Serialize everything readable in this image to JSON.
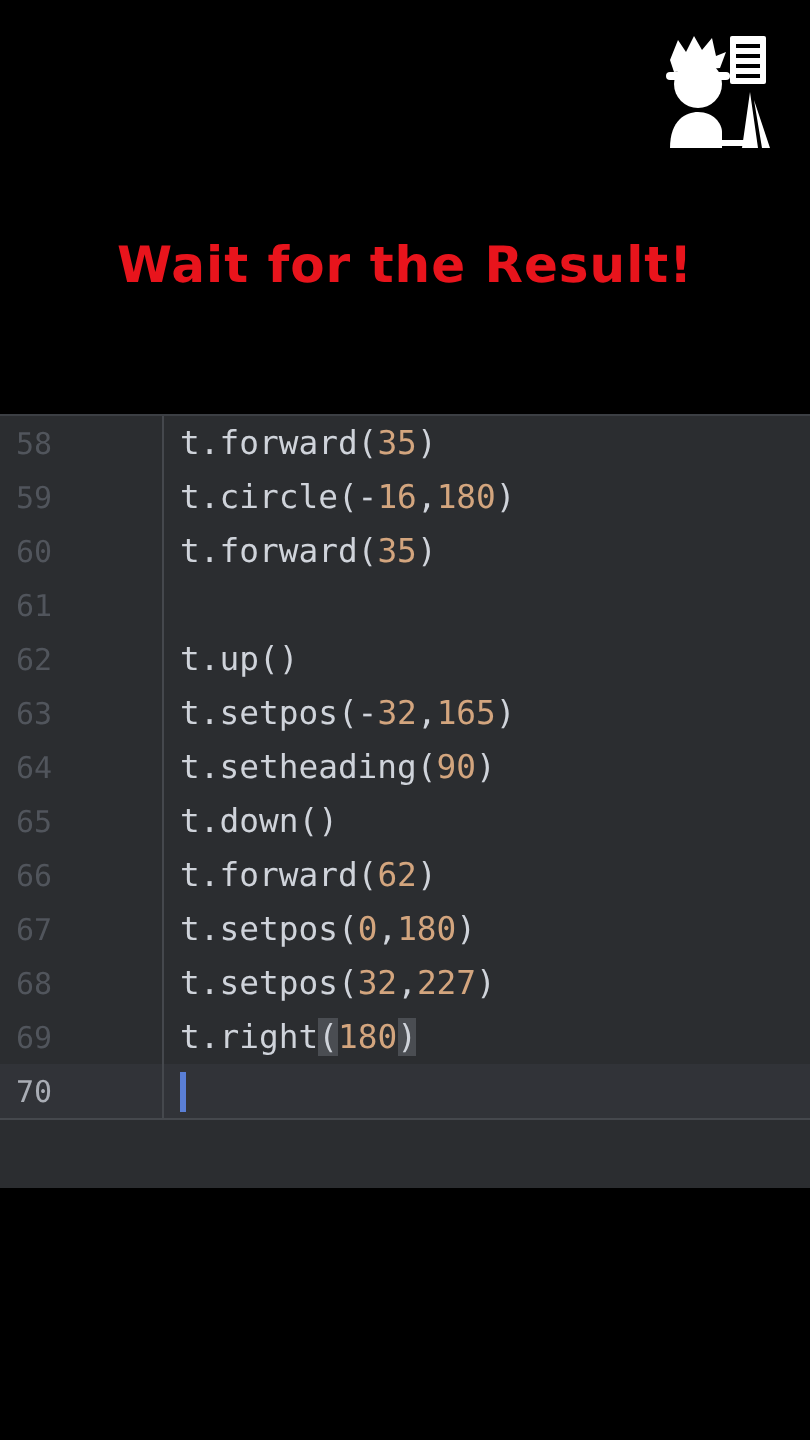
{
  "title": "Wait for the Result!",
  "editor": {
    "lines": [
      {
        "number": "58",
        "current": false,
        "code": "t.forward(35)"
      },
      {
        "number": "59",
        "current": false,
        "code": "t.circle(-16,180)"
      },
      {
        "number": "60",
        "current": false,
        "code": "t.forward(35)"
      },
      {
        "number": "61",
        "current": false
      },
      {
        "number": "62",
        "current": false,
        "code": "t.up()"
      },
      {
        "number": "63",
        "current": false,
        "code": "t.setpos(-32,165)"
      },
      {
        "number": "64",
        "current": false,
        "code": "t.setheading(90)"
      },
      {
        "number": "65",
        "current": false,
        "code": "t.down()"
      },
      {
        "number": "66",
        "current": false,
        "code": "t.forward(62)"
      },
      {
        "number": "67",
        "current": false,
        "code": "t.setpos(0,180)"
      },
      {
        "number": "68",
        "current": false,
        "code": "t.setpos(32,227)"
      },
      {
        "number": "69",
        "current": false,
        "code": "t.right(180)",
        "brackets_matched": true
      },
      {
        "number": "70",
        "current": true
      }
    ]
  }
}
